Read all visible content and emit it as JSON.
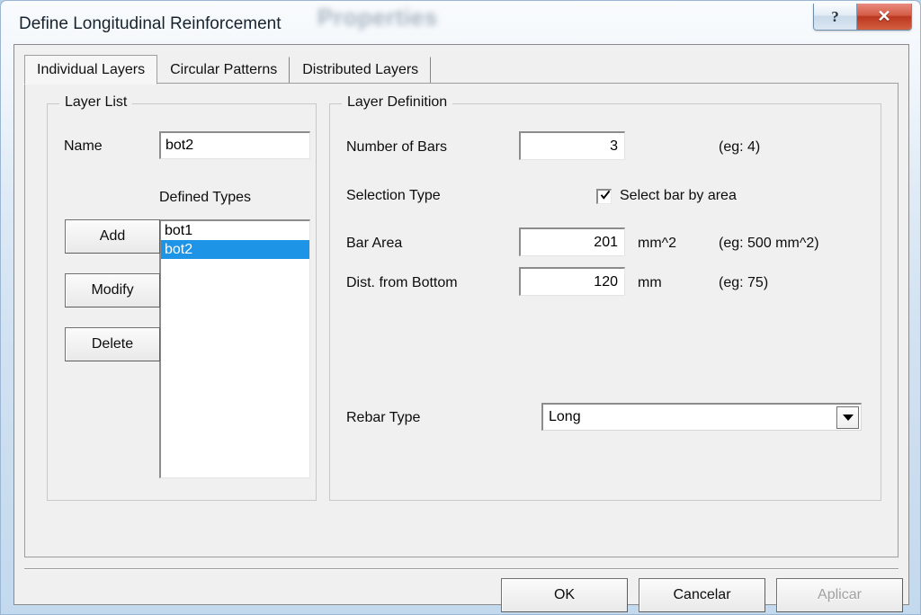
{
  "window": {
    "title": "Define Longitudinal Reinforcement",
    "background_blur_text": "Properties",
    "help_button": "?",
    "close_button": "✕"
  },
  "tabs": [
    {
      "label": "Individual Layers",
      "active": true
    },
    {
      "label": "Circular Patterns",
      "active": false
    },
    {
      "label": "Distributed Layers",
      "active": false
    }
  ],
  "layer_list": {
    "legend": "Layer List",
    "name_label": "Name",
    "name_value": "bot2",
    "defined_types_label": "Defined Types",
    "items": [
      {
        "label": "bot1",
        "selected": false
      },
      {
        "label": "bot2",
        "selected": true
      }
    ],
    "buttons": {
      "add": "Add",
      "modify": "Modify",
      "delete": "Delete"
    }
  },
  "layer_definition": {
    "legend": "Layer Definition",
    "number_of_bars": {
      "label": "Number of Bars",
      "value": "3",
      "hint": "(eg:    4)"
    },
    "selection_type": {
      "label": "Selection Type",
      "checkbox_label": "Select bar by area",
      "checked": true
    },
    "bar_area": {
      "label": "Bar Area",
      "value": "201",
      "unit": "mm^2",
      "hint": "(eg:  500 mm^2)"
    },
    "dist_from_bottom": {
      "label": "Dist. from Bottom",
      "value": "120",
      "unit": "mm",
      "hint": "(eg:   75)"
    },
    "rebar_type": {
      "label": "Rebar Type",
      "value": "Long"
    }
  },
  "footer": {
    "ok": "OK",
    "cancel": "Cancelar",
    "apply": "Aplicar",
    "apply_disabled": true
  },
  "colors": {
    "selection_blue": "#1e94e6",
    "close_red": "#bb3720",
    "dialog_face": "#f0f0f0"
  }
}
